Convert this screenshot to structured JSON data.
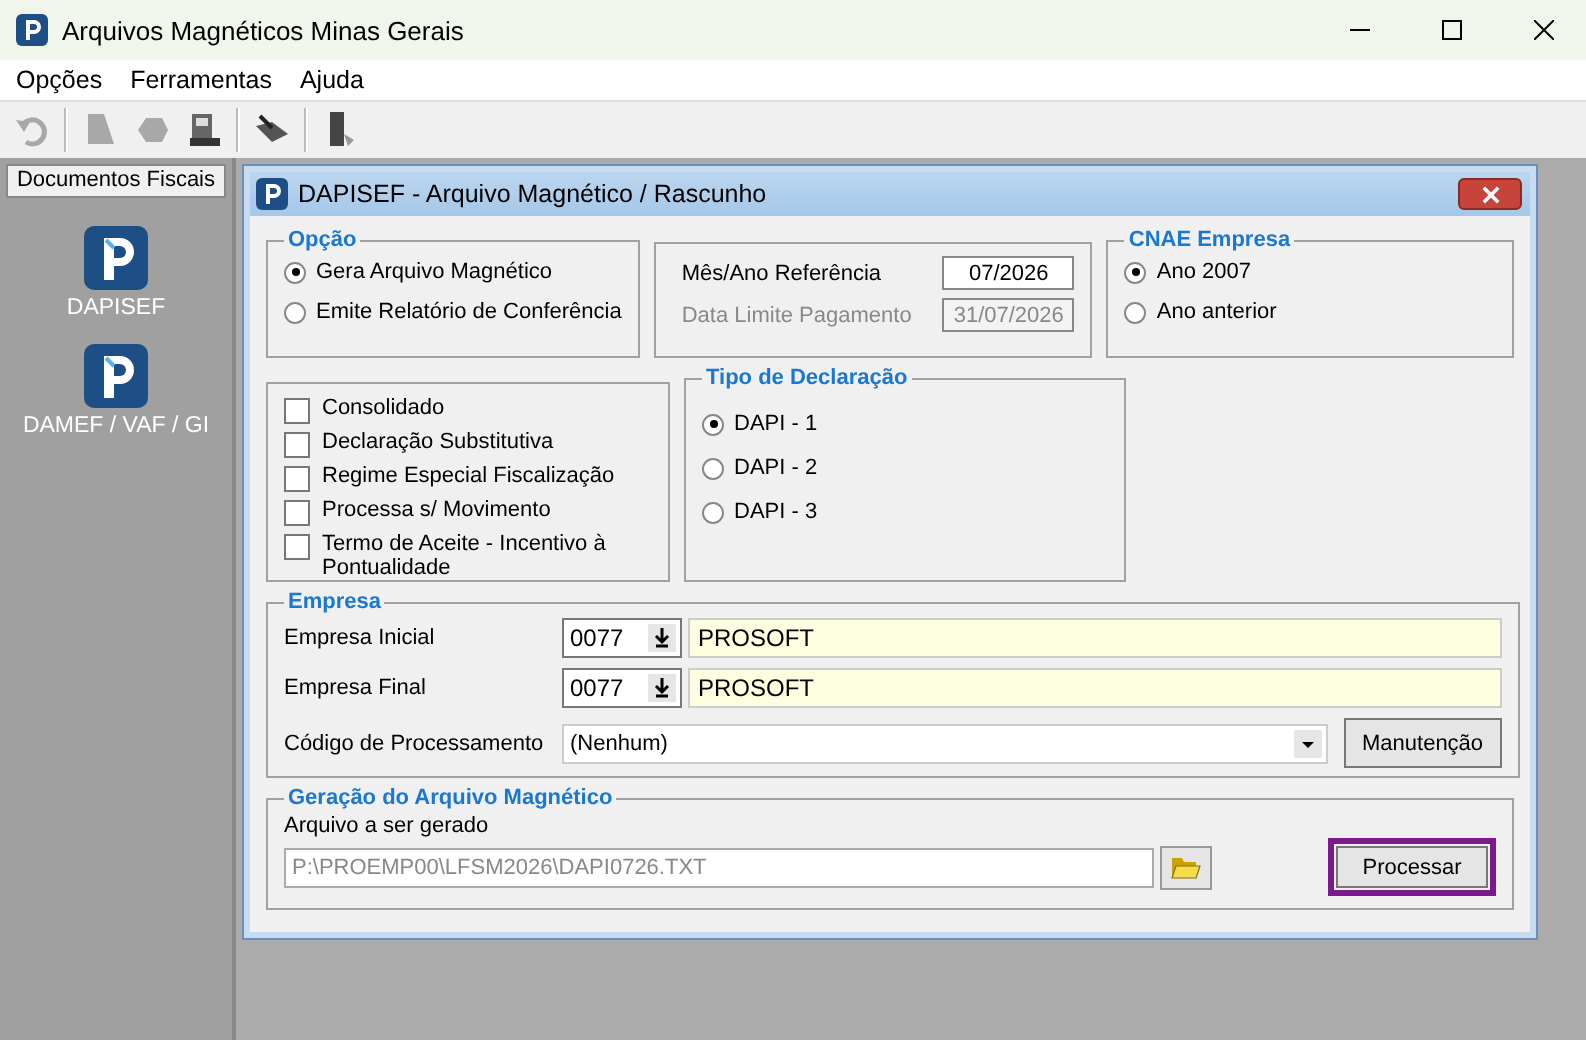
{
  "window": {
    "title": "Arquivos Magnéticos Minas Gerais"
  },
  "menu": [
    "Opções",
    "Ferramentas",
    "Ajuda"
  ],
  "toolbar": [
    {
      "kind": "undo",
      "disabled": true
    },
    {
      "kind": "sep"
    },
    {
      "kind": "document",
      "disabled": true
    },
    {
      "kind": "blob",
      "disabled": true
    },
    {
      "kind": "machine",
      "disabled": false
    },
    {
      "kind": "sep"
    },
    {
      "kind": "tool",
      "disabled": false
    },
    {
      "kind": "sep"
    },
    {
      "kind": "door",
      "disabled": false
    }
  ],
  "sidebar": {
    "title": "Documentos Fiscais",
    "items": [
      {
        "label": "DAPISEF"
      },
      {
        "label": "DAMEF / VAF / GI"
      }
    ]
  },
  "dialog": {
    "title": "DAPISEF - Arquivo Magnético / Rascunho",
    "opcao": {
      "title": "Opção",
      "options": [
        {
          "label": "Gera Arquivo Magnético",
          "selected": true
        },
        {
          "label": "Emite Relatório de Conferência",
          "selected": false
        }
      ]
    },
    "periodo": [
      {
        "label": "Mês/Ano Referência",
        "value": "07/2026",
        "disabled": false
      },
      {
        "label": "Data Limite Pagamento",
        "value": "31/07/2026",
        "disabled": true
      }
    ],
    "cnae": {
      "title": "CNAE Empresa",
      "options": [
        {
          "label": "Ano 2007",
          "selected": true
        },
        {
          "label": "Ano anterior",
          "selected": false
        }
      ]
    },
    "flags": [
      {
        "label": "Consolidado",
        "checked": false
      },
      {
        "label": "Declaração Substitutiva",
        "checked": false
      },
      {
        "label": "Regime Especial Fiscalização",
        "checked": false
      },
      {
        "label": "Processa s/ Movimento",
        "checked": false
      },
      {
        "label": "Termo de Aceite - Incentivo à Pontualidade",
        "checked": false
      }
    ],
    "tipo": {
      "title": "Tipo de Declaração",
      "options": [
        {
          "label": "DAPI - 1",
          "selected": true
        },
        {
          "label": "DAPI - 2",
          "selected": false
        },
        {
          "label": "DAPI - 3",
          "selected": false
        }
      ]
    },
    "empresa": {
      "title": "Empresa",
      "rows": [
        {
          "label": "Empresa Inicial",
          "code": "0077",
          "name": "PROSOFT"
        },
        {
          "label": "Empresa Final",
          "code": "0077",
          "name": "PROSOFT"
        }
      ],
      "codigo": {
        "label": "Código de Processamento",
        "value": "(Nenhum)"
      },
      "button": "Manutenção"
    },
    "geracao": {
      "title": "Geração do Arquivo Magnético",
      "label": "Arquivo a ser gerado",
      "path": "P:\\PROEMP00\\LFSM2026\\DAPI0726.TXT",
      "button": "Processar"
    }
  }
}
